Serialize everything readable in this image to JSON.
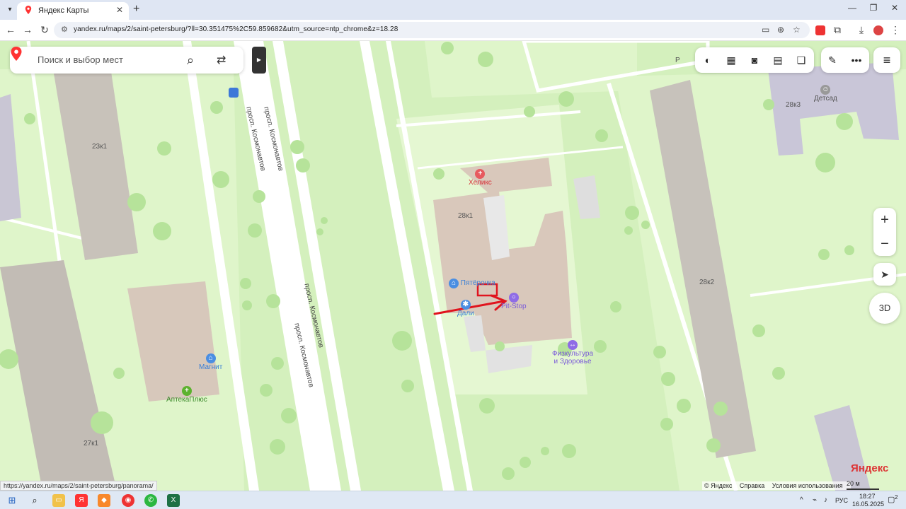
{
  "browser": {
    "tab_title": "Яндекс Карты",
    "url": "yandex.ru/maps/2/saint-petersburg/?ll=30.351475%2C59.859682&utm_source=ntp_chrome&z=18.28",
    "status_url": "https://yandex.ru/maps/2/saint-petersburg/panorama/"
  },
  "map": {
    "search_placeholder": "Поиск и выбор мест",
    "road_label": "просп. Космонавтов",
    "buildings": {
      "b23k1": "23к1",
      "b28k1": "28к1",
      "b28k2": "28к2",
      "b28k3": "28к3",
      "b27k1": "27к1"
    },
    "pois": {
      "heliks": "Хеликс",
      "pyaterochka": "Пятёрочка",
      "pitstop": "Pit-Stop",
      "dali": "Дали",
      "fizkultura1": "Физкультура",
      "fizkultura2": "и Здоровье",
      "magnit": "Магнит",
      "apteka": "АптекаПлюс",
      "detsad": "Детсад"
    },
    "parking_letter": "P",
    "zoom_in": "+",
    "zoom_out": "−",
    "btn_3d": "3D",
    "brand": "Яндекс",
    "copyright": [
      "© Яндекс",
      "Справка",
      "Условия использования"
    ],
    "scale_label": "20 м"
  },
  "taskbar": {
    "lang": "РУС",
    "time": "18:27",
    "date": "16.05.2025",
    "notif_count": "2"
  },
  "colors": {
    "park": "#d4f0bd",
    "road": "#ffffff",
    "building": "#d8c9bd",
    "residential": "#c9c6d4",
    "annotation": "#e0141e"
  }
}
